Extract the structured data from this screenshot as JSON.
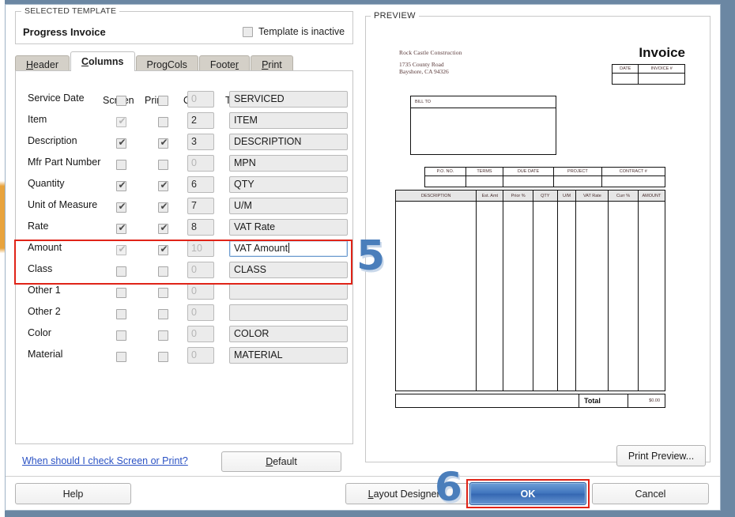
{
  "window": {
    "selected_template_legend": "SELECTED TEMPLATE",
    "template_name": "Progress Invoice",
    "inactive_label": "Template is inactive",
    "inactive_checked": false
  },
  "tabs": [
    {
      "label": "Header",
      "accel": "H",
      "active": false
    },
    {
      "label": "Columns",
      "accel": "C",
      "active": true
    },
    {
      "label": "Prog Cols",
      "accel": "g",
      "active": false
    },
    {
      "label": "Footer",
      "accel": "r",
      "active": false
    },
    {
      "label": "Print",
      "accel": "P",
      "active": false
    }
  ],
  "columns_grid": {
    "headers": {
      "name": "",
      "screen": "Screen",
      "print": "Print",
      "order": "Order",
      "title": "Title"
    },
    "rows": [
      {
        "name": "Service Date",
        "screen": "unchecked",
        "print": "unchecked",
        "order": "0",
        "order_dim": true,
        "title": "SERVICED",
        "focused": false,
        "highlighted": false
      },
      {
        "name": "Item",
        "screen": "checked-dim",
        "print": "unchecked",
        "order": "2",
        "order_dim": false,
        "title": "ITEM",
        "focused": false,
        "highlighted": false
      },
      {
        "name": "Description",
        "screen": "checked",
        "print": "checked",
        "order": "3",
        "order_dim": false,
        "title": "DESCRIPTION",
        "focused": false,
        "highlighted": false
      },
      {
        "name": "Mfr Part Number",
        "screen": "unchecked",
        "print": "unchecked",
        "order": "0",
        "order_dim": true,
        "title": "MPN",
        "focused": false,
        "highlighted": false
      },
      {
        "name": "Quantity",
        "screen": "checked",
        "print": "checked",
        "order": "6",
        "order_dim": false,
        "title": "QTY",
        "focused": false,
        "highlighted": false
      },
      {
        "name": "Unit of Measure",
        "screen": "checked",
        "print": "checked",
        "order": "7",
        "order_dim": false,
        "title": "U/M",
        "focused": false,
        "highlighted": false
      },
      {
        "name": "Rate",
        "screen": "checked",
        "print": "checked",
        "order": "8",
        "order_dim": false,
        "title": "VAT Rate",
        "focused": false,
        "highlighted": true
      },
      {
        "name": "Amount",
        "screen": "checked-dim",
        "print": "checked",
        "order": "10",
        "order_dim": true,
        "title": "VAT Amount",
        "focused": true,
        "highlighted": true
      },
      {
        "name": "Class",
        "screen": "unchecked",
        "print": "unchecked",
        "order": "0",
        "order_dim": true,
        "title": "CLASS",
        "focused": false,
        "highlighted": false
      },
      {
        "name": "Other 1",
        "screen": "unchecked",
        "print": "unchecked",
        "order": "0",
        "order_dim": true,
        "title": "",
        "focused": false,
        "highlighted": false
      },
      {
        "name": "Other 2",
        "screen": "unchecked",
        "print": "unchecked",
        "order": "0",
        "order_dim": true,
        "title": "",
        "focused": false,
        "highlighted": false
      },
      {
        "name": "Color",
        "screen": "unchecked",
        "print": "unchecked",
        "order": "0",
        "order_dim": true,
        "title": "COLOR",
        "focused": false,
        "highlighted": false
      },
      {
        "name": "Material",
        "screen": "unchecked",
        "print": "unchecked",
        "order": "0",
        "order_dim": true,
        "title": "MATERIAL",
        "focused": false,
        "highlighted": false
      }
    ]
  },
  "left_footer": {
    "help_link": "When should I check Screen or Print?",
    "default_button": "Default",
    "default_accel": "D"
  },
  "preview": {
    "legend": "PREVIEW",
    "company": "Rock Castle Construction",
    "address_line1": "1735 County Road",
    "address_line2": "Bayshore, CA 94326",
    "doc_title": "Invoice",
    "date_header": "DATE",
    "invoice_no_header": "INVOICE #",
    "bill_to_label": "BILL TO",
    "meta_headers": [
      "P.O. NO.",
      "TERMS",
      "DUE DATE",
      "PROJECT",
      "CONTRACT #"
    ],
    "item_headers": [
      "DESCRIPTION",
      "Est. Amt",
      "Prior %",
      "QTY",
      "U/M",
      "VAT Rate",
      "Curr %",
      "AMOUNT"
    ],
    "total_label": "Total",
    "total_value": "$0.00",
    "print_preview_button": "Print Preview..."
  },
  "footer_buttons": {
    "help": "Help",
    "layout_designer": "Layout Designer...",
    "layout_accel": "L",
    "ok": "OK",
    "cancel": "Cancel"
  },
  "annotations": {
    "step5": "5",
    "step6": "6"
  },
  "colors": {
    "highlight_red": "#e02418",
    "marker_blue": "#4a7ebb",
    "ok_blue": "#3f74bd",
    "link_blue": "#2b52c4",
    "window_chrome": "#6b87a3"
  }
}
